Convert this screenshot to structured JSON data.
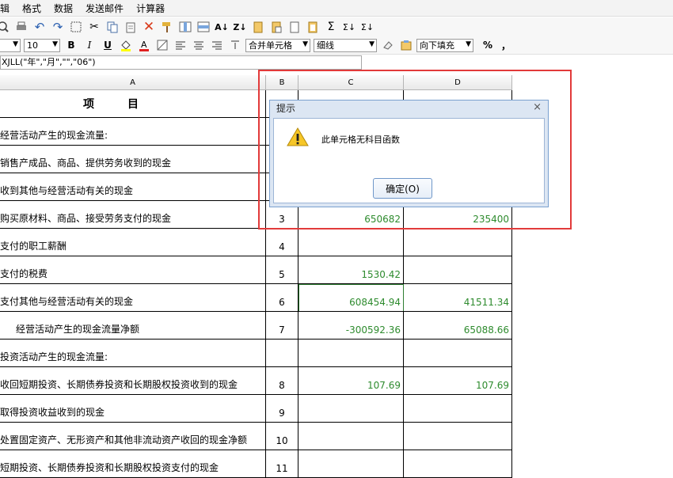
{
  "menu": [
    "辑",
    "格式",
    "数据",
    "发送邮件",
    "计算器"
  ],
  "toolbar": {
    "font_size": "10",
    "bold": "B",
    "italic": "I",
    "underline": "U",
    "sum1": "Σ",
    "sum2": "Σ↓",
    "sum3": "Σ↓",
    "merge": "合并单元格",
    "border": "细线",
    "fill": "向下填充",
    "percent": "%",
    "comma": "，"
  },
  "formula_text": "XJLL(\"年\",\"月\",\"\",\"06\")",
  "columns": {
    "a": "A",
    "b": "B",
    "c": "C",
    "d": "D"
  },
  "rows": [
    {
      "label": "项　　　目",
      "b": "",
      "c": "",
      "d": ""
    },
    {
      "label": "经营活动产生的现金流量:",
      "b": "",
      "c": "",
      "d": ""
    },
    {
      "label": "销售产成品、商品、提供劳务收到的现金",
      "b": "",
      "c": "",
      "d": ""
    },
    {
      "label": "收到其他与经营活动有关的现金",
      "b": "",
      "c": "",
      "d": ""
    },
    {
      "label": "购买原材料、商品、接受劳务支付的现金",
      "b": "3",
      "c": "650682",
      "d": "235400"
    },
    {
      "label": "支付的职工薪酬",
      "b": "4",
      "c": "",
      "d": ""
    },
    {
      "label": "支付的税费",
      "b": "5",
      "c": "1530.42",
      "d": ""
    },
    {
      "label": "支付其他与经营活动有关的现金",
      "b": "6",
      "c": "608454.94",
      "d": "41511.34"
    },
    {
      "label": "经营活动产生的现金流量净额",
      "b": "7",
      "c": "-300592.36",
      "d": "65088.66"
    },
    {
      "label": "投资活动产生的现金流量:",
      "b": "",
      "c": "",
      "d": ""
    },
    {
      "label": "收回短期投资、长期债券投资和长期股权投资收到的现金",
      "b": "8",
      "c": "107.69",
      "d": "107.69"
    },
    {
      "label": "取得投资收益收到的现金",
      "b": "9",
      "c": "",
      "d": ""
    },
    {
      "label": "处置固定资产、无形资产和其他非流动资产收回的现金净额",
      "b": "10",
      "c": "",
      "d": ""
    },
    {
      "label": "短期投资、长期债券投资和长期股权投资支付的现金",
      "b": "11",
      "c": "",
      "d": ""
    }
  ],
  "dialog": {
    "title": "提示",
    "message": "此单元格无科目函数",
    "ok": "确定(O)",
    "close": "×"
  }
}
